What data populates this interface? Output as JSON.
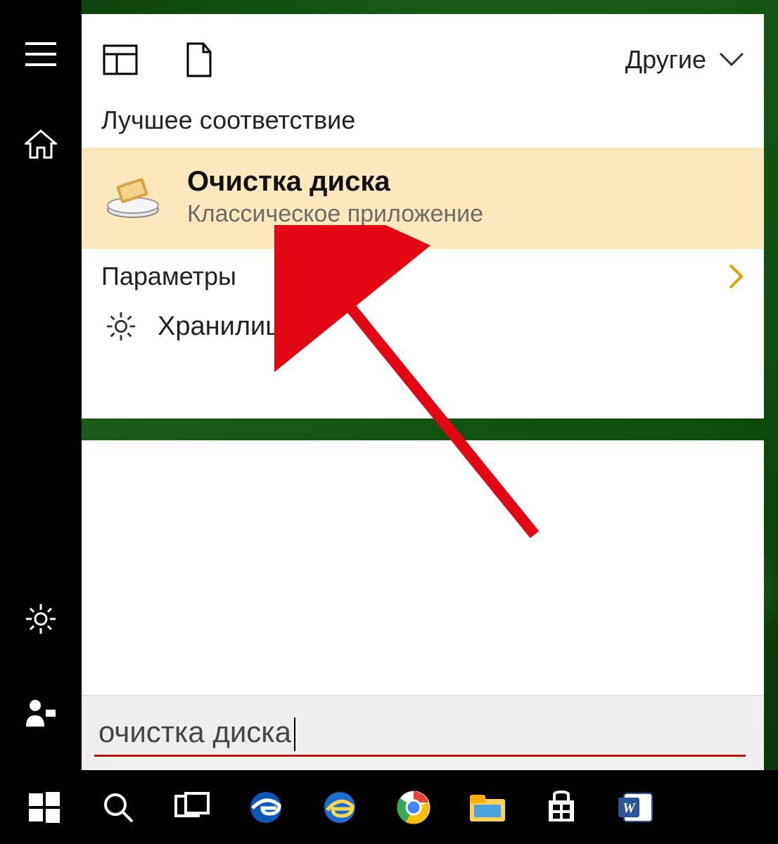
{
  "header": {
    "other_label": "Другие"
  },
  "sections": {
    "best_match_label": "Лучшее соответствие",
    "settings_label": "Параметры"
  },
  "best_match": {
    "title": "Очистка диска",
    "subtitle": "Классическое приложение"
  },
  "settings_items": {
    "storage_label": "Хранилище"
  },
  "search": {
    "query": "очистка диска"
  },
  "colors": {
    "highlight_bg": "#fbe9bd",
    "arrow": "#e30613",
    "underline": "#c41414",
    "chevron_accent": "#d6a400"
  }
}
